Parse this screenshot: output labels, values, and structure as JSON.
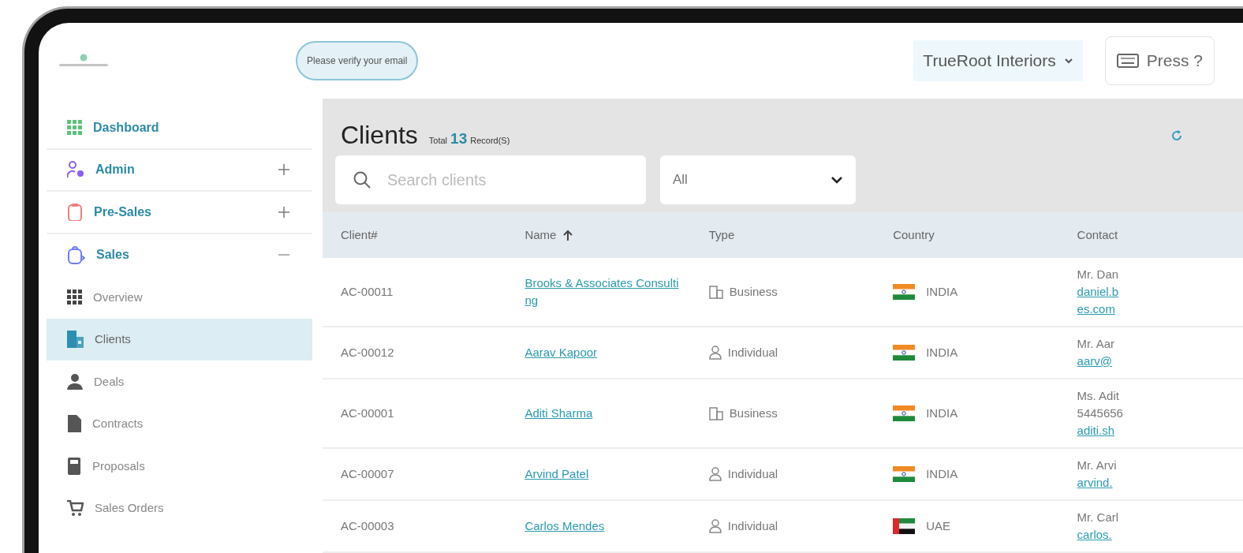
{
  "header": {
    "verify_badge": "Please verify your email",
    "company": "TrueRoot Interiors",
    "shortcut_button": "Press ?"
  },
  "sidebar": {
    "items": [
      {
        "label": "Dashboard",
        "kind": "link"
      },
      {
        "label": "Admin",
        "kind": "group",
        "expanded": false
      },
      {
        "label": "Pre-Sales",
        "kind": "group",
        "expanded": false
      },
      {
        "label": "Sales",
        "kind": "group",
        "expanded": true,
        "children": [
          {
            "label": "Overview",
            "selected": false
          },
          {
            "label": "Clients",
            "selected": true
          },
          {
            "label": "Deals",
            "selected": false
          },
          {
            "label": "Contracts",
            "selected": false
          },
          {
            "label": "Proposals",
            "selected": false
          },
          {
            "label": "Sales Orders",
            "selected": false
          }
        ]
      }
    ]
  },
  "page": {
    "title": "Clients",
    "total_label": "Total",
    "total_count": "13",
    "total_suffix": "Record(S)",
    "search": {
      "placeholder": "Search clients"
    },
    "filter": "All"
  },
  "table": {
    "columns": [
      {
        "label": "Client#",
        "kind": "plain"
      },
      {
        "label": "Name",
        "kind": "sorted_asc"
      },
      {
        "label": "Type",
        "kind": "plain"
      },
      {
        "label": "Country",
        "kind": "plain"
      },
      {
        "label": "Contact",
        "kind": "plain"
      }
    ],
    "rows": [
      {
        "client_no": "AC-00011",
        "name": "Brooks & Associates Consulting",
        "type": {
          "label": "Business",
          "kind": "business"
        },
        "country": {
          "label": "INDIA",
          "kind": "india"
        },
        "contact": [
          {
            "text": "Mr. Dan",
            "kind": "text"
          },
          {
            "text": "daniel.b",
            "kind": "email"
          },
          {
            "text": "es.com",
            "kind": "email"
          }
        ]
      },
      {
        "client_no": "AC-00012",
        "name": "Aarav Kapoor",
        "type": {
          "label": "Individual",
          "kind": "individual"
        },
        "country": {
          "label": "INDIA",
          "kind": "india"
        },
        "contact": [
          {
            "text": "Mr. Aar",
            "kind": "text"
          },
          {
            "text": "aarv@",
            "kind": "email"
          }
        ]
      },
      {
        "client_no": "AC-00001",
        "name": "Aditi Sharma",
        "type": {
          "label": "Business",
          "kind": "business"
        },
        "country": {
          "label": "INDIA",
          "kind": "india"
        },
        "contact": [
          {
            "text": "Ms. Adit",
            "kind": "text"
          },
          {
            "text": "5445656",
            "kind": "text"
          },
          {
            "text": "aditi.sh",
            "kind": "email"
          }
        ]
      },
      {
        "client_no": "AC-00007",
        "name": "Arvind Patel",
        "type": {
          "label": "Individual",
          "kind": "individual"
        },
        "country": {
          "label": "INDIA",
          "kind": "india"
        },
        "contact": [
          {
            "text": "Mr. Arvi",
            "kind": "text"
          },
          {
            "text": "arvind.",
            "kind": "email"
          }
        ]
      },
      {
        "client_no": "AC-00003",
        "name": "Carlos Mendes",
        "type": {
          "label": "Individual",
          "kind": "individual"
        },
        "country": {
          "label": "UAE",
          "kind": "uae"
        },
        "contact": [
          {
            "text": "Mr. Carl",
            "kind": "text"
          },
          {
            "text": "carlos.",
            "kind": "email"
          }
        ]
      }
    ]
  }
}
